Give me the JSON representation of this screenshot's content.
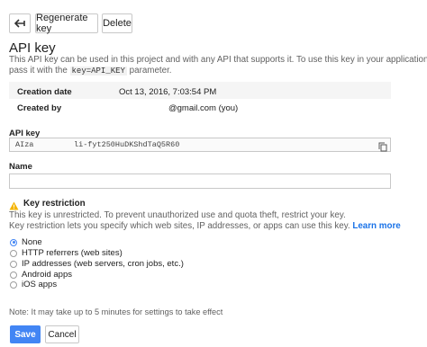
{
  "toolbar": {
    "back_icon": "arrow-left-icon",
    "regenerate_label": "Regenerate key",
    "delete_label": "Delete"
  },
  "header": {
    "title": "API key",
    "description_line1": "This API key can be used in this project and with any API that supports it. To use this key in your application,",
    "description_line2_pre": "pass it with the ",
    "description_code": "key=API_KEY",
    "description_line2_post": " parameter."
  },
  "info": {
    "creation_label": "Creation date",
    "creation_value": "Oct 13, 2016, 7:03:54 PM",
    "created_by_label": "Created by",
    "created_by_value": "@gmail.com (you)"
  },
  "api_key": {
    "label": "API key",
    "value_prefix": "AIza",
    "value_suffix": "li-fyt250HuDKShdTaQ5R60",
    "copy_icon": "copy-icon"
  },
  "name": {
    "label": "Name",
    "value": ""
  },
  "restriction": {
    "warning_icon": "warning-icon",
    "title": "Key restriction",
    "line1": "This key is unrestricted. To prevent unauthorized use and quota theft, restrict your key.",
    "line2": "Key restriction lets you specify which web sites, IP addresses, or apps can use this key.",
    "learn_more": "Learn more",
    "options": [
      "None",
      "HTTP referrers (web sites)",
      "IP addresses (web servers, cron jobs, etc.)",
      "Android apps",
      "iOS apps"
    ],
    "selected": "None"
  },
  "note": "Note: It may take up to 5 minutes for settings to take effect",
  "actions": {
    "save_label": "Save",
    "cancel_label": "Cancel"
  },
  "colors": {
    "accent": "#4285f4",
    "warning": "#f4b400",
    "link": "#1a73e8"
  }
}
